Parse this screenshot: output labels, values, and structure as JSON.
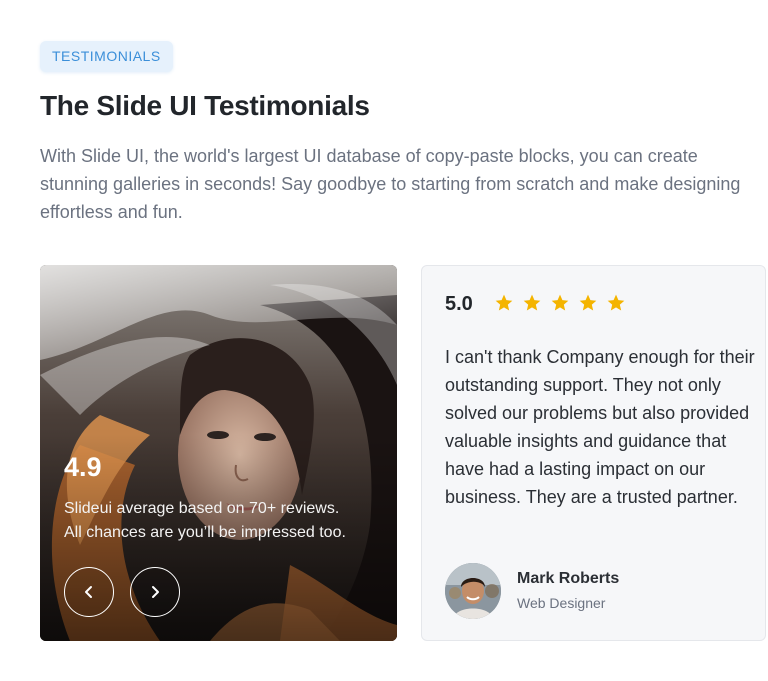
{
  "section": {
    "badge": "TESTIMONIALS",
    "title": "The Slide UI Testimonials",
    "description": "With Slide UI, the world's largest UI database of copy-paste blocks, you can create stunning galleries in seconds! Say goodbye to starting from scratch and make designing effortless and fun."
  },
  "photo_card": {
    "rating": "4.9",
    "rating_text_line1": "Slideui average based on 70+ reviews.",
    "rating_text_line2": "All chances are you’ll be impressed too.",
    "prev_icon": "chevron-left-icon",
    "next_icon": "chevron-right-icon"
  },
  "testimonial": {
    "score": "5.0",
    "stars": 5,
    "star_color": "#f4b400",
    "quote": "I can't thank Company enough for their outstanding support. They not only solved our problems but also provided valuable insights and guidance that have had a lasting impact on our business. They are a trusted partner.",
    "author_name": "Mark Roberts",
    "author_role": "Web Designer"
  },
  "colors": {
    "badge_bg": "#e6f1fc",
    "badge_text": "#3b8fd9",
    "card_bg": "#f6f7f9"
  }
}
